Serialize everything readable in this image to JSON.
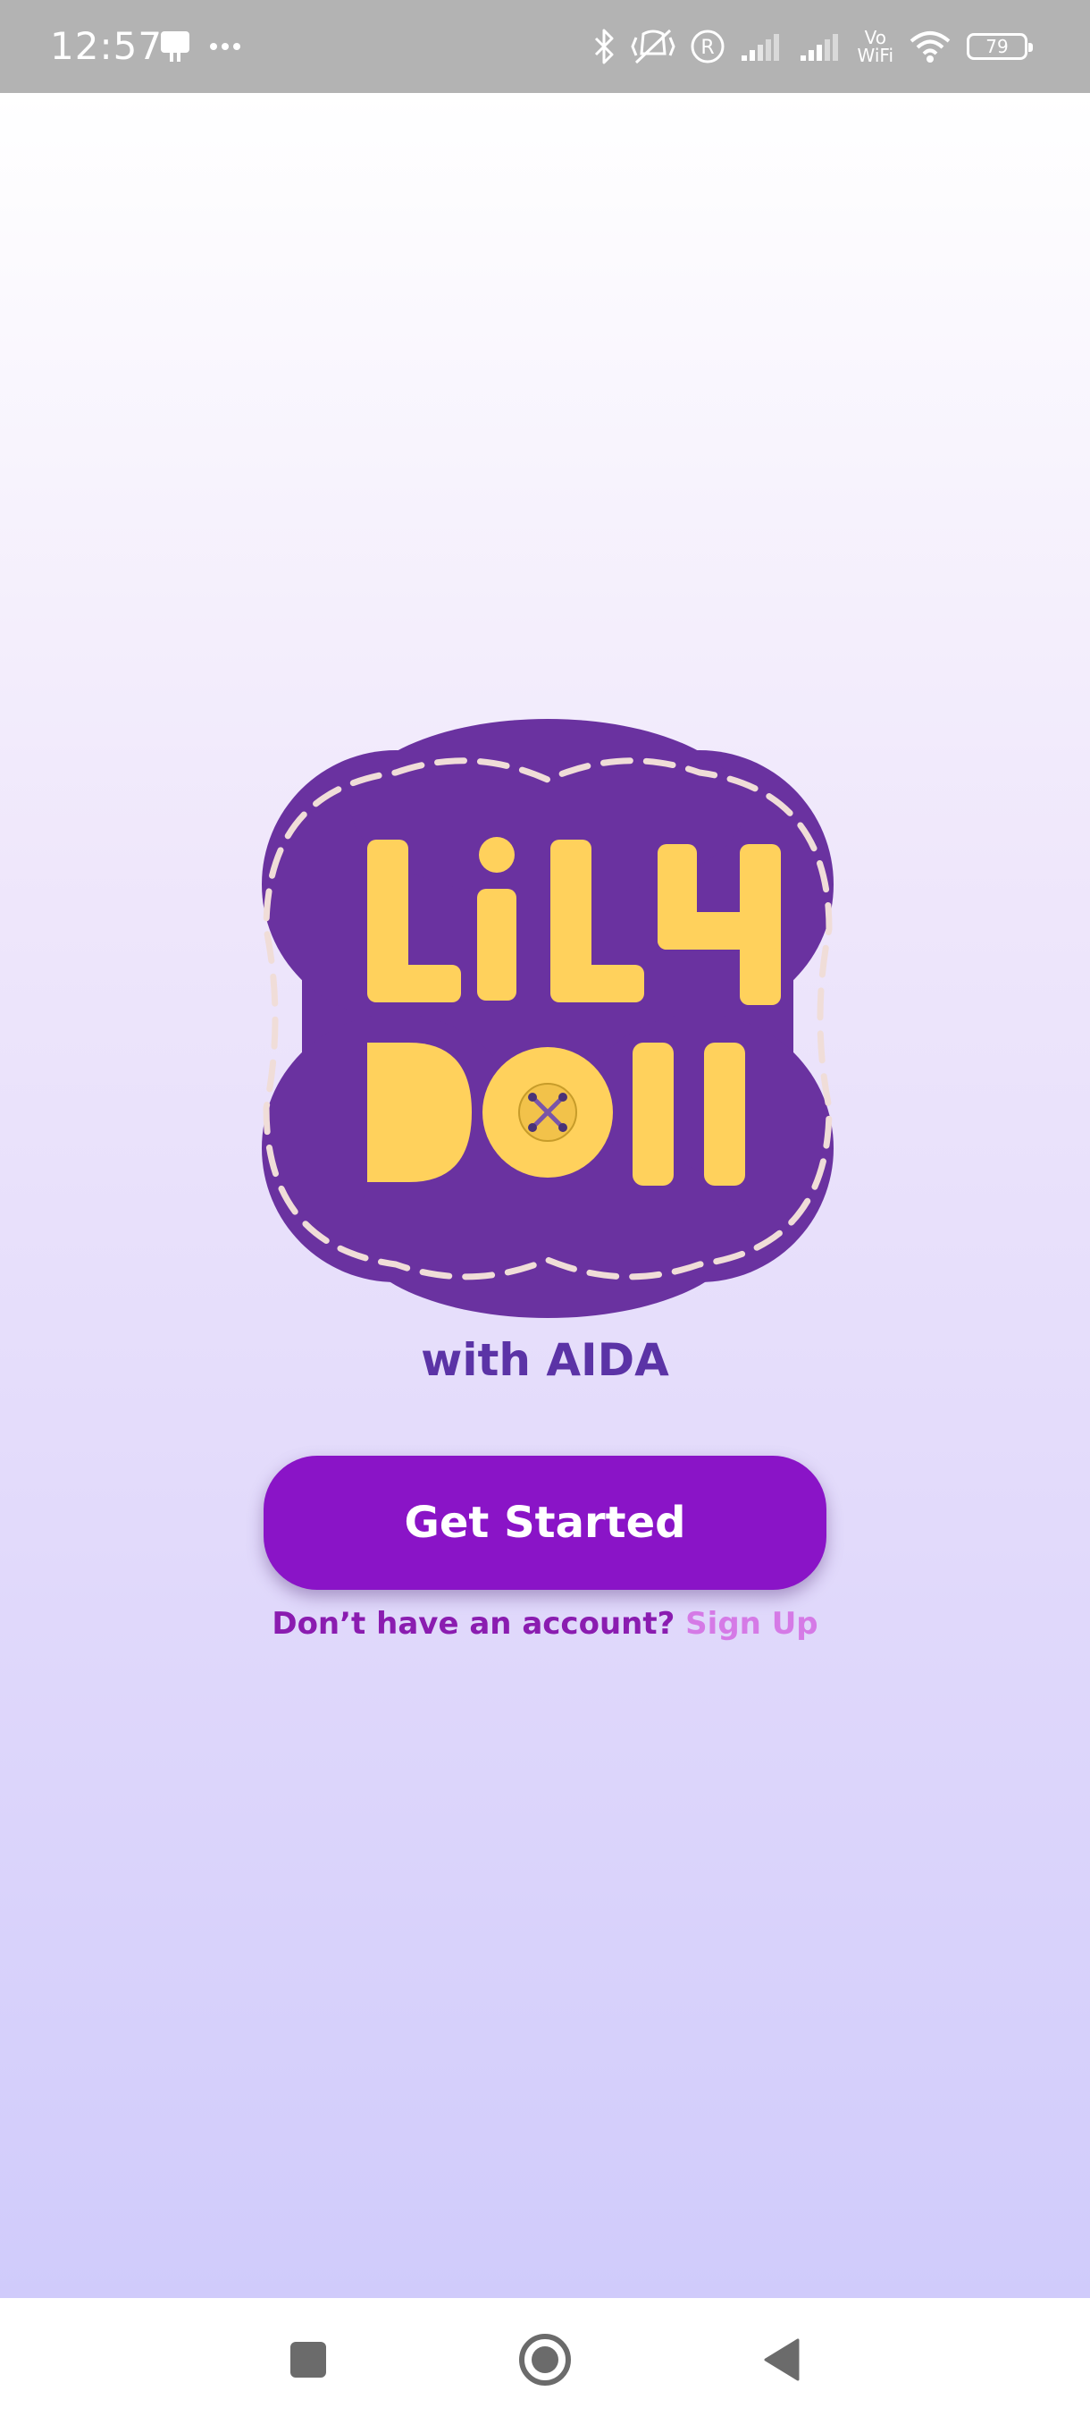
{
  "status_bar": {
    "time": "12:57",
    "battery_level": "79",
    "wifi_label_top": "Vo",
    "wifi_label_bottom": "WiFi",
    "icons": [
      "notification-icon",
      "more-dots-icon",
      "bluetooth-icon",
      "vibrate-off-icon",
      "registered-icon",
      "signal-icon",
      "signal-icon",
      "vowifi-icon",
      "wifi-icon",
      "battery-icon"
    ]
  },
  "logo": {
    "line1": "LiLy",
    "line2": "Doll",
    "colors": {
      "badge": "#6a32a0",
      "letters": "#ffd15c",
      "stitch": "#f0ddd8"
    }
  },
  "tagline": "with AIDA",
  "cta": {
    "label": "Get Started",
    "color": "#8a14c7"
  },
  "signup": {
    "prompt": "Don’t have an account?",
    "link": "Sign Up"
  },
  "nav_bar": {
    "icons": [
      "recents-square-icon",
      "home-circle-icon",
      "back-triangle-icon"
    ]
  }
}
